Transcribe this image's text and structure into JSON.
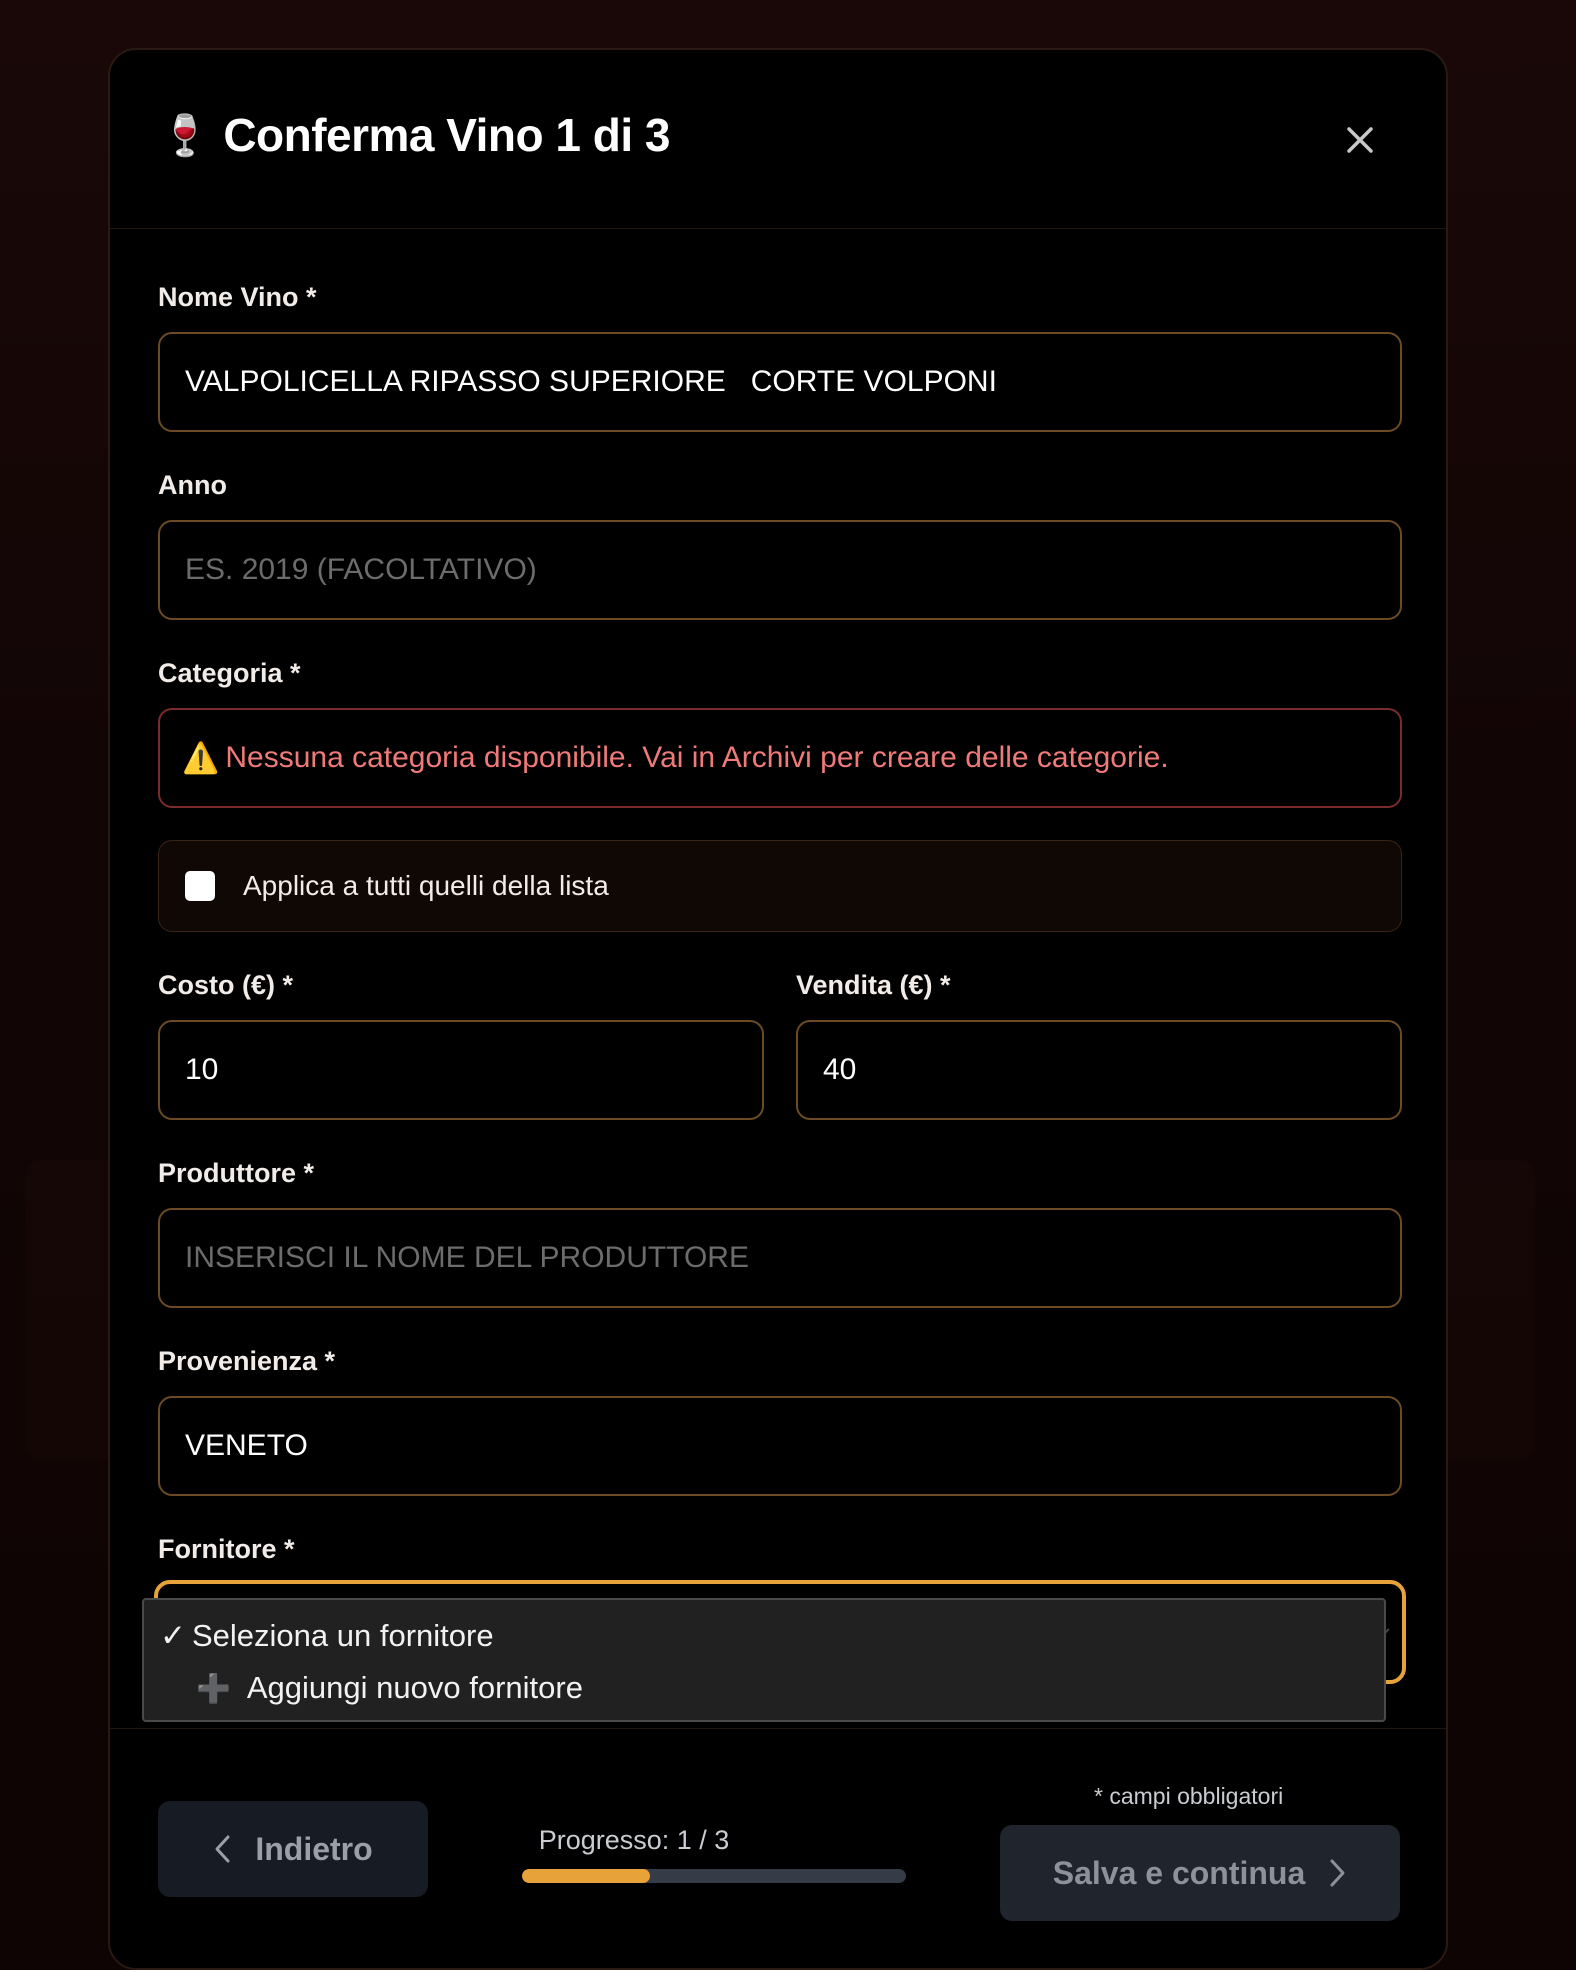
{
  "header": {
    "emoji": "🍷",
    "title": "Conferma Vino 1 di 3"
  },
  "fields": {
    "nome_vino": {
      "label": "Nome Vino *",
      "value": "VALPOLICELLA RIPASSO SUPERIORE   CORTE VOLPONI"
    },
    "anno": {
      "label": "Anno",
      "placeholder": "ES. 2019 (FACOLTATIVO)"
    },
    "categoria": {
      "label": "Categoria *",
      "warning_icon": "⚠️",
      "error": "Nessuna categoria disponibile. Vai in Archivi per creare delle categorie."
    },
    "applica": {
      "label": "Applica a tutti quelli della lista",
      "checked": false
    },
    "costo": {
      "label": "Costo (€) *",
      "value": "10"
    },
    "vendita": {
      "label": "Vendita (€) *",
      "value": "40"
    },
    "produttore": {
      "label": "Produttore *",
      "placeholder": "INSERISCI IL NOME DEL PRODUTTORE"
    },
    "provenienza": {
      "label": "Provenienza *",
      "value": "VENETO"
    },
    "fornitore": {
      "label": "Fornitore *",
      "options": [
        {
          "check": "✓",
          "label": "Seleziona un fornitore",
          "selected": true
        },
        {
          "icon": "➕",
          "label": "Aggiungi nuovo fornitore",
          "selected": false
        }
      ]
    }
  },
  "footer": {
    "back_label": "Indietro",
    "progress_label": "Progresso: 1 / 3",
    "progress_fraction": 0.333,
    "required_note": "* campi obbligatori",
    "save_label": "Salva e continua"
  },
  "colors": {
    "accent": "#e8a23a",
    "error_text": "#f07a7a",
    "field_border": "#6b4a24"
  }
}
